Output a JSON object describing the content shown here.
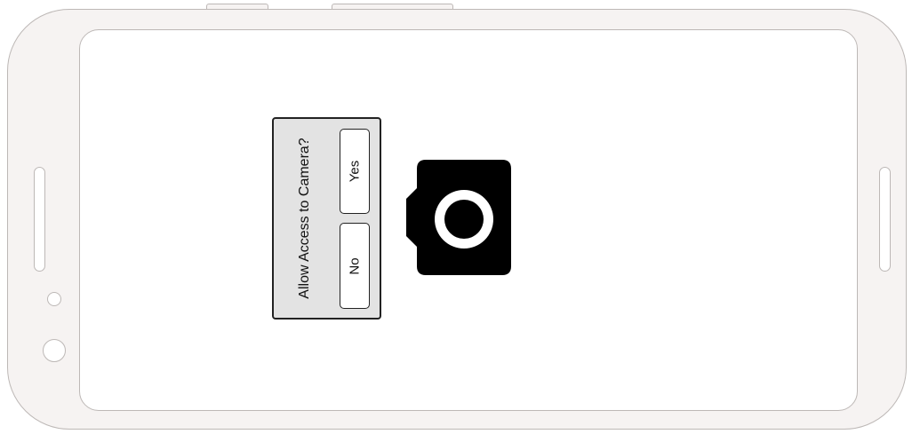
{
  "dialog": {
    "title": "Allow Access to Camera?",
    "yes_label": "Yes",
    "no_label": "No"
  },
  "icons": {
    "camera": "camera-icon"
  },
  "colors": {
    "phone_body": "#f6f3f2",
    "phone_outline": "#bdb8b6",
    "dialog_bg": "#e3e3e3",
    "camera": "#000000"
  }
}
